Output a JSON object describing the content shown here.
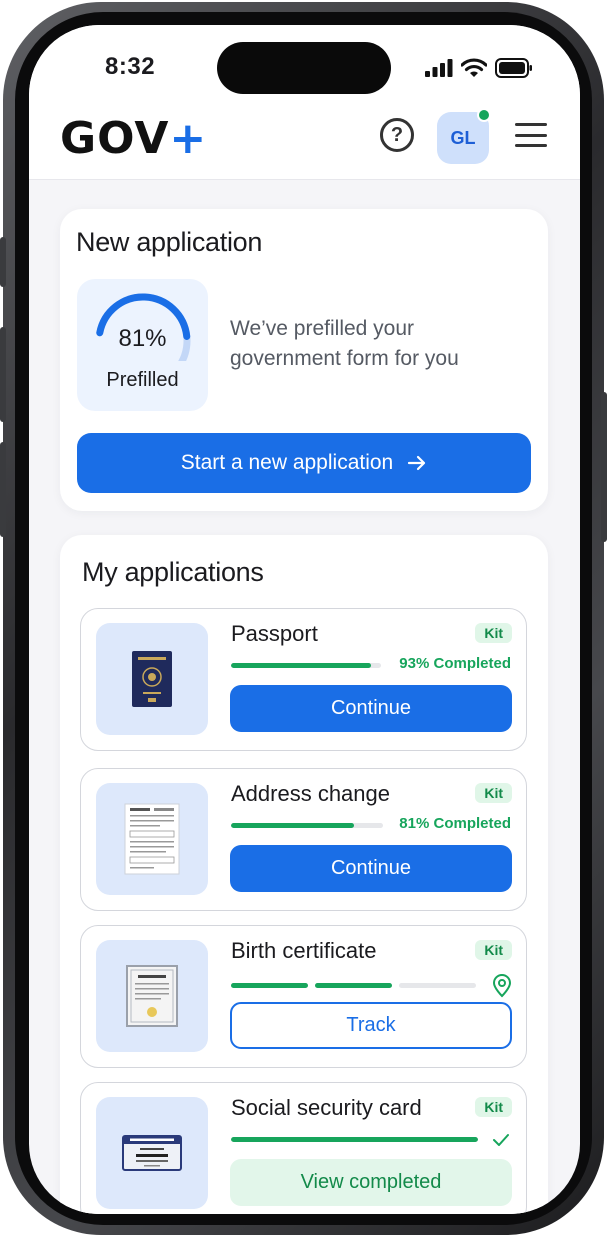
{
  "status_bar": {
    "time": "8:32"
  },
  "header": {
    "logo_text": "GOV",
    "logo_plus": "+",
    "help_icon": "?",
    "avatar_initials": "GL",
    "avatar_status_color": "#17a55c"
  },
  "new_application": {
    "title": "New application",
    "prefill_percent": 81,
    "prefill_percent_label": "81%",
    "prefill_label": "Prefilled",
    "prefill_message": "We’ve prefilled your government form for you",
    "start_button_label": "Start a new application",
    "start_button_icon": "arrow-right-icon"
  },
  "my_applications": {
    "title": "My applications",
    "items": [
      {
        "name": "Passport",
        "badge": "Kit",
        "progress_percent": 93,
        "progress_label": "93% Completed",
        "action_label": "Continue",
        "action_style": "primary",
        "thumbnail": "passport-icon"
      },
      {
        "name": "Address change",
        "badge": "Kit",
        "progress_percent": 81,
        "progress_label": "81% Completed",
        "action_label": "Continue",
        "action_style": "primary",
        "thumbnail": "form-document-icon"
      },
      {
        "name": "Birth certificate",
        "badge": "Kit",
        "tracking_steps_total": 3,
        "tracking_steps_done": 2,
        "status_icon": "location-pin-icon",
        "action_label": "Track",
        "action_style": "outline",
        "thumbnail": "certificate-icon"
      },
      {
        "name": "Social security card",
        "badge": "Kit",
        "progress_percent": 100,
        "status_icon": "checkmark-icon",
        "action_label": "View completed",
        "action_style": "green",
        "thumbnail": "social-security-card-icon"
      }
    ]
  },
  "colors": {
    "primary": "#1a6ee6",
    "success": "#17a55c",
    "success_bg": "#e2f6ea",
    "thumb_bg": "#dde8fb"
  }
}
